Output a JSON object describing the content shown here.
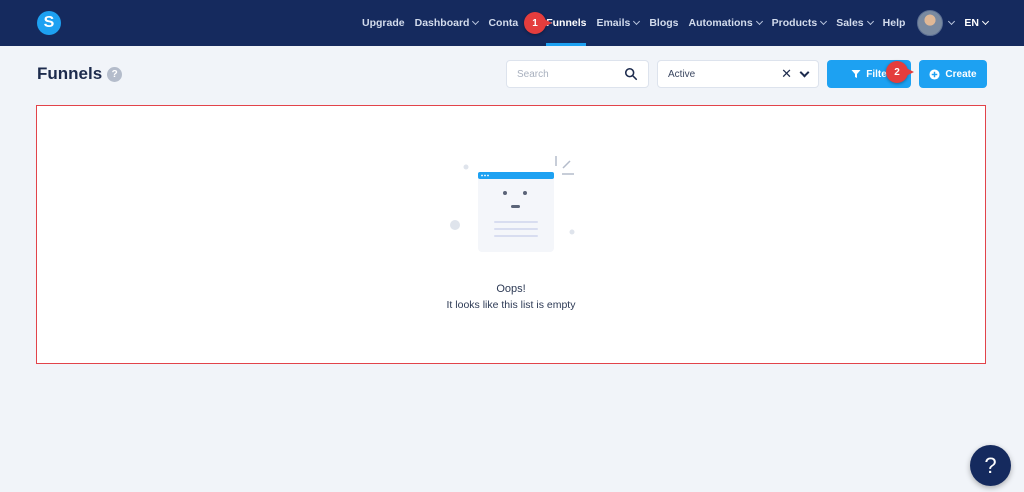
{
  "app": {
    "logo_letter": "S"
  },
  "nav": {
    "items": [
      {
        "label": "Upgrade",
        "dropdown": false,
        "active": false
      },
      {
        "label": "Dashboard",
        "dropdown": true,
        "active": false
      },
      {
        "label": "Conta",
        "dropdown": false,
        "active": false
      },
      {
        "label": "Funnels",
        "dropdown": false,
        "active": true
      },
      {
        "label": "Emails",
        "dropdown": true,
        "active": false
      },
      {
        "label": "Blogs",
        "dropdown": false,
        "active": false
      },
      {
        "label": "Automations",
        "dropdown": true,
        "active": false
      },
      {
        "label": "Products",
        "dropdown": true,
        "active": false
      },
      {
        "label": "Sales",
        "dropdown": true,
        "active": false
      },
      {
        "label": "Help",
        "dropdown": false,
        "active": false
      }
    ],
    "language": "EN"
  },
  "annotations": {
    "step1": "1",
    "step2": "2"
  },
  "page": {
    "title": "Funnels",
    "help_glyph": "?"
  },
  "toolbar": {
    "search_placeholder": "Search",
    "status_value": "Active",
    "clear_glyph": "✕",
    "filter_label": "Filte",
    "create_label": "Create"
  },
  "empty_state": {
    "title": "Oops!",
    "message": "It looks like this list is empty"
  },
  "help_fab": {
    "glyph": "?"
  },
  "colors": {
    "topbar": "#152a5e",
    "accent": "#1da1f2",
    "annotation_red": "#e43d3d",
    "page_bg": "#f1f4f9"
  },
  "icons": {
    "logo": "s-logo-icon",
    "search": "search-icon",
    "filter": "filter-funnel-icon",
    "create": "plus-circle-icon",
    "help": "question-icon"
  }
}
